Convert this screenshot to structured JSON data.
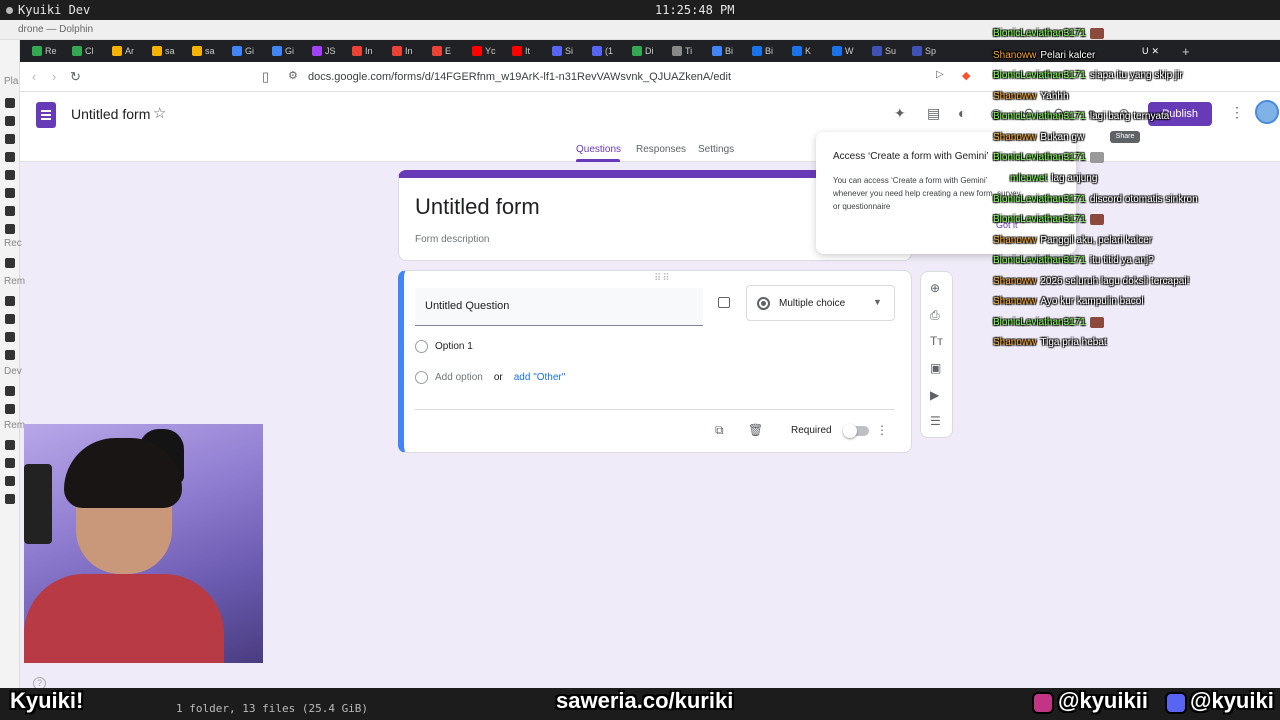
{
  "os": {
    "window_title": "Kyuiki Dev",
    "clock": "11:25:48 PM",
    "file_manager": "drone — Dolphin"
  },
  "browser": {
    "tabs": [
      "Re",
      "Cl",
      "Ar",
      "sa",
      "sa",
      "Gi",
      "Gi",
      "JS",
      "In",
      "In",
      "E",
      "Yc",
      "It",
      "Si",
      "(1",
      "Di",
      "Ti",
      "Bi",
      "Bi",
      "K",
      "W",
      "Su",
      "Sp",
      "U"
    ],
    "url": "docs.google.com/forms/d/14FGERfnm_w19ArK-lf1-n31RevVAWsvnk_QJUAZkenA/edit"
  },
  "forms": {
    "doc_title": "Untitled form",
    "publish_label": "Publish",
    "share_tooltip": "Share",
    "nav_tabs": [
      "Questions",
      "Responses",
      "Settings"
    ],
    "title_card": {
      "title": "Untitled form",
      "description_placeholder": "Form description"
    },
    "question": {
      "title": "Untitled Question",
      "type": "Multiple choice",
      "option1": "Option 1",
      "add_option": "Add option",
      "or": "or",
      "add_other": "add \"Other\"",
      "required_label": "Required"
    },
    "gemini_popup": {
      "heading": "Access ‘Create a form with Gemini’",
      "body": "You can access ‘Create a form with Gemini’ whenever you need help creating a new form, survey or questionnaire",
      "button": "Got it"
    }
  },
  "chat": [
    {
      "user": "BionicLeviathan3171",
      "text": "",
      "color": "#7cfc4c"
    },
    {
      "user": "Shanoww",
      "text": "Pelari kalcer",
      "color": "#f5a623"
    },
    {
      "user": "BionicLeviathan3171",
      "text": "siapa itu yang skip jir",
      "color": "#7cfc4c"
    },
    {
      "user": "Shanoww",
      "text": "Yahhh",
      "color": "#f5a623"
    },
    {
      "user": "BionicLeviathan3171",
      "text": "lagi bang ternyata",
      "color": "#7cfc4c"
    },
    {
      "user": "Shanoww",
      "text": "Bukan gw",
      "color": "#f5a623"
    },
    {
      "user": "BionicLeviathan3171",
      "text": "",
      "color": "#7cfc4c"
    },
    {
      "user": "mleowet",
      "text": "lag anjung",
      "color": "#7cfc4c"
    },
    {
      "user": "BionicLeviathan3171",
      "text": "discord otomatis sinkron",
      "color": "#7cfc4c"
    },
    {
      "user": "BionicLeviathan3171",
      "text": "",
      "color": "#7cfc4c"
    },
    {
      "user": "Shanoww",
      "text": "Panggil aku, pelari kalcer",
      "color": "#f5a623"
    },
    {
      "user": "BionicLeviathan3171",
      "text": "itu titid ya anj?",
      "color": "#7cfc4c"
    },
    {
      "user": "Shanoww",
      "text": "2026 seluruh lagu doksli tercapai!",
      "color": "#f5a623"
    },
    {
      "user": "Shanoww",
      "text": "Ayo kur kampulin bacol",
      "color": "#f5a623"
    },
    {
      "user": "BionicLeviathan3171",
      "text": "",
      "color": "#7cfc4c"
    },
    {
      "user": "Shanoww",
      "text": "Tiga pria hebat",
      "color": "#f5a623"
    }
  ],
  "overlay": {
    "name": "Kyuiki!",
    "saweria": "saweria.co/kuriki",
    "instagram": "@kyuikii",
    "discord": "@kyuiki",
    "files_status": "1 folder, 13 files (25.4 GiB)"
  },
  "sidebar_labels": [
    "Pla",
    "Rec",
    "Rem",
    "Dev",
    "Rem"
  ]
}
